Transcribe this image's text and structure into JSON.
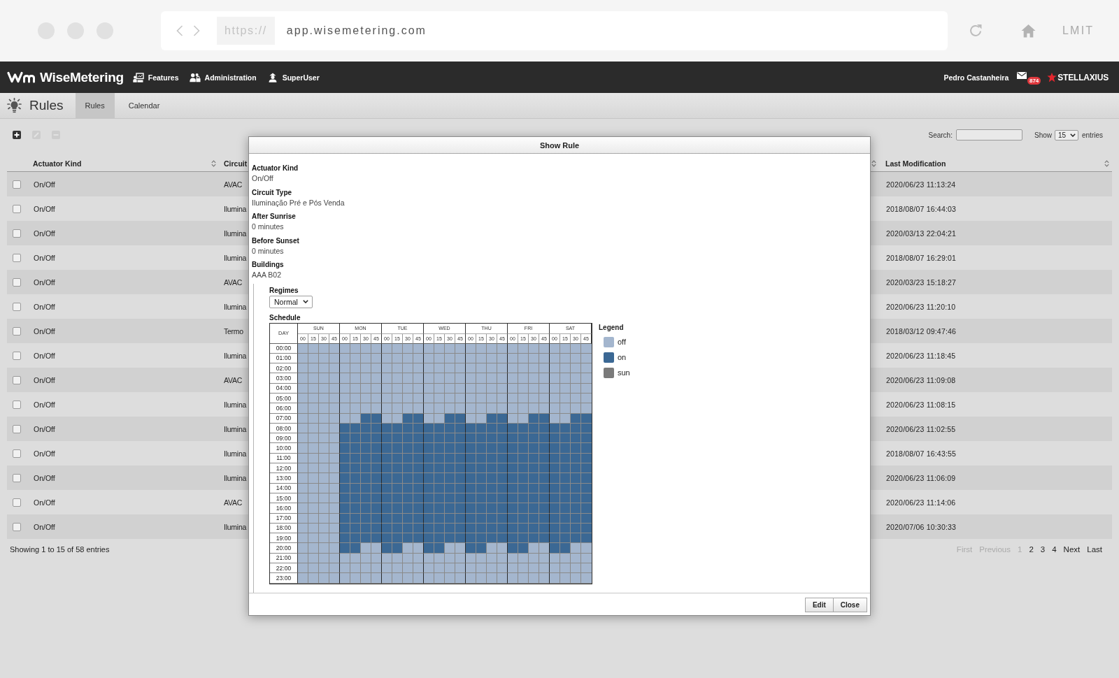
{
  "browser": {
    "scheme": "https://",
    "url": "app.wisemetering.com",
    "profile": "LMIT"
  },
  "header": {
    "logo": "WiseMetering",
    "nav": [
      {
        "label": "Features",
        "kind": "board"
      },
      {
        "label": "Administration",
        "kind": "users"
      },
      {
        "label": "SuperUser",
        "kind": "user"
      }
    ],
    "user": "Pedro Castanheira",
    "mail_count": "874",
    "company": "STELLAXIUS"
  },
  "page": {
    "title": "Rules",
    "tabs": [
      {
        "label": "Rules",
        "selected": true
      },
      {
        "label": "Calendar",
        "selected": false
      }
    ]
  },
  "toolbar": {
    "actions": [
      {
        "kind": "add",
        "disabled": false
      },
      {
        "kind": "edit",
        "disabled": true
      },
      {
        "kind": "remove",
        "disabled": true
      }
    ]
  },
  "table_controls": {
    "search_label": "Search:",
    "show_label": "Show",
    "page_size": "15",
    "entries_label": "entries"
  },
  "table": {
    "columns": [
      {
        "label": "Actuator Kind"
      },
      {
        "label": "Circuit"
      },
      {
        "label": "Last Modification"
      }
    ],
    "rows": [
      {
        "checked": false,
        "actuator_kind": "On/Off",
        "circuit": "AVAC",
        "last_modification": "2020/06/23 11:13:24"
      },
      {
        "checked": false,
        "actuator_kind": "On/Off",
        "circuit": "Ilumina",
        "last_modification": "2018/08/07 16:44:03"
      },
      {
        "checked": false,
        "actuator_kind": "On/Off",
        "circuit": "Ilumina",
        "last_modification": "2020/03/13 22:04:21"
      },
      {
        "checked": false,
        "actuator_kind": "On/Off",
        "circuit": "Ilumina",
        "last_modification": "2018/08/07 16:29:01"
      },
      {
        "checked": false,
        "actuator_kind": "On/Off",
        "circuit": "AVAC",
        "last_modification": "2020/03/23 15:18:27"
      },
      {
        "checked": false,
        "actuator_kind": "On/Off",
        "circuit": "Ilumina",
        "last_modification": "2020/06/23 11:20:10"
      },
      {
        "checked": false,
        "actuator_kind": "On/Off",
        "circuit": "Termo",
        "last_modification": "2018/03/12 09:47:46"
      },
      {
        "checked": false,
        "actuator_kind": "On/Off",
        "circuit": "Ilumina",
        "last_modification": "2020/06/23 11:18:45"
      },
      {
        "checked": false,
        "actuator_kind": "On/Off",
        "circuit": "AVAC",
        "last_modification": "2020/06/23 11:09:08"
      },
      {
        "checked": false,
        "actuator_kind": "On/Off",
        "circuit": "Ilumina",
        "last_modification": "2020/06/23 11:08:15"
      },
      {
        "checked": false,
        "actuator_kind": "On/Off",
        "circuit": "Ilumina",
        "last_modification": "2020/06/23 11:02:55"
      },
      {
        "checked": false,
        "actuator_kind": "On/Off",
        "circuit": "Ilumina",
        "last_modification": "2018/08/07 16:43:55"
      },
      {
        "checked": false,
        "actuator_kind": "On/Off",
        "circuit": "Ilumina",
        "last_modification": "2020/06/23 11:06:09"
      },
      {
        "checked": false,
        "actuator_kind": "On/Off",
        "circuit": "AVAC",
        "last_modification": "2020/06/23 11:14:06"
      },
      {
        "checked": false,
        "actuator_kind": "On/Off",
        "circuit": "Ilumina",
        "last_modification": "2020/07/06 10:30:33"
      }
    ]
  },
  "footer": {
    "info": "Showing 1 to 15 of 58 entries",
    "pagination": [
      {
        "label": "First",
        "disabled": true
      },
      {
        "label": "Previous",
        "disabled": true
      },
      {
        "label": "1",
        "disabled": true
      },
      {
        "label": "2",
        "disabled": false
      },
      {
        "label": "3",
        "disabled": false
      },
      {
        "label": "4",
        "disabled": false
      },
      {
        "label": "Next",
        "disabled": false
      },
      {
        "label": "Last",
        "disabled": false
      }
    ]
  },
  "dialog": {
    "title": "Show Rule",
    "fields": [
      {
        "label": "Actuator Kind",
        "value": "On/Off"
      },
      {
        "label": "Circuit Type",
        "value": "Iluminação Pré e Pós Venda"
      },
      {
        "label": "After Sunrise",
        "value": "0 minutes"
      },
      {
        "label": "Before Sunset",
        "value": "0 minutes"
      },
      {
        "label": "Buildings",
        "value": "AAA B02"
      }
    ],
    "regimes": {
      "label": "Regimes",
      "value": "Normal"
    },
    "schedule": {
      "label": "Schedule",
      "corner": "DAY",
      "days": [
        {
          "label": "SUN",
          "quarters": [
            "00",
            "15",
            "30",
            "45"
          ]
        },
        {
          "label": "MON",
          "quarters": [
            "00",
            "15",
            "30",
            "45"
          ]
        },
        {
          "label": "TUE",
          "quarters": [
            "00",
            "15",
            "30",
            "45"
          ]
        },
        {
          "label": "WED",
          "quarters": [
            "00",
            "15",
            "30",
            "45"
          ]
        },
        {
          "label": "THU",
          "quarters": [
            "00",
            "15",
            "30",
            "45"
          ]
        },
        {
          "label": "FRI",
          "quarters": [
            "00",
            "15",
            "30",
            "45"
          ]
        },
        {
          "label": "SAT",
          "quarters": [
            "00",
            "15",
            "30",
            "45"
          ]
        }
      ],
      "rows": [
        {
          "time": "00:00",
          "on": [
            false,
            false,
            false,
            false,
            false,
            false,
            false,
            false,
            false,
            false,
            false,
            false,
            false,
            false,
            false,
            false,
            false,
            false,
            false,
            false,
            false,
            false,
            false,
            false,
            false,
            false,
            false,
            false
          ]
        },
        {
          "time": "01:00",
          "on": [
            false,
            false,
            false,
            false,
            false,
            false,
            false,
            false,
            false,
            false,
            false,
            false,
            false,
            false,
            false,
            false,
            false,
            false,
            false,
            false,
            false,
            false,
            false,
            false,
            false,
            false,
            false,
            false
          ]
        },
        {
          "time": "02:00",
          "on": [
            false,
            false,
            false,
            false,
            false,
            false,
            false,
            false,
            false,
            false,
            false,
            false,
            false,
            false,
            false,
            false,
            false,
            false,
            false,
            false,
            false,
            false,
            false,
            false,
            false,
            false,
            false,
            false
          ]
        },
        {
          "time": "03:00",
          "on": [
            false,
            false,
            false,
            false,
            false,
            false,
            false,
            false,
            false,
            false,
            false,
            false,
            false,
            false,
            false,
            false,
            false,
            false,
            false,
            false,
            false,
            false,
            false,
            false,
            false,
            false,
            false,
            false
          ]
        },
        {
          "time": "04:00",
          "on": [
            false,
            false,
            false,
            false,
            false,
            false,
            false,
            false,
            false,
            false,
            false,
            false,
            false,
            false,
            false,
            false,
            false,
            false,
            false,
            false,
            false,
            false,
            false,
            false,
            false,
            false,
            false,
            false
          ]
        },
        {
          "time": "05:00",
          "on": [
            false,
            false,
            false,
            false,
            false,
            false,
            false,
            false,
            false,
            false,
            false,
            false,
            false,
            false,
            false,
            false,
            false,
            false,
            false,
            false,
            false,
            false,
            false,
            false,
            false,
            false,
            false,
            false
          ]
        },
        {
          "time": "06:00",
          "on": [
            false,
            false,
            false,
            false,
            false,
            false,
            false,
            false,
            false,
            false,
            false,
            false,
            false,
            false,
            false,
            false,
            false,
            false,
            false,
            false,
            false,
            false,
            false,
            false,
            false,
            false,
            false,
            false
          ]
        },
        {
          "time": "07:00",
          "on": [
            false,
            false,
            false,
            false,
            false,
            false,
            true,
            true,
            false,
            false,
            true,
            true,
            false,
            false,
            true,
            true,
            false,
            false,
            true,
            true,
            false,
            false,
            true,
            true,
            false,
            false,
            true,
            true
          ]
        },
        {
          "time": "08:00",
          "on": [
            false,
            false,
            false,
            false,
            true,
            true,
            true,
            true,
            true,
            true,
            true,
            true,
            true,
            true,
            true,
            true,
            true,
            true,
            true,
            true,
            true,
            true,
            true,
            true,
            true,
            true,
            true,
            true
          ]
        },
        {
          "time": "09:00",
          "on": [
            false,
            false,
            false,
            false,
            true,
            true,
            true,
            true,
            true,
            true,
            true,
            true,
            true,
            true,
            true,
            true,
            true,
            true,
            true,
            true,
            true,
            true,
            true,
            true,
            true,
            true,
            true,
            true
          ]
        },
        {
          "time": "10:00",
          "on": [
            false,
            false,
            false,
            false,
            true,
            true,
            true,
            true,
            true,
            true,
            true,
            true,
            true,
            true,
            true,
            true,
            true,
            true,
            true,
            true,
            true,
            true,
            true,
            true,
            true,
            true,
            true,
            true
          ]
        },
        {
          "time": "11:00",
          "on": [
            false,
            false,
            false,
            false,
            true,
            true,
            true,
            true,
            true,
            true,
            true,
            true,
            true,
            true,
            true,
            true,
            true,
            true,
            true,
            true,
            true,
            true,
            true,
            true,
            true,
            true,
            true,
            true
          ]
        },
        {
          "time": "12:00",
          "on": [
            false,
            false,
            false,
            false,
            true,
            true,
            true,
            true,
            true,
            true,
            true,
            true,
            true,
            true,
            true,
            true,
            true,
            true,
            true,
            true,
            true,
            true,
            true,
            true,
            true,
            true,
            true,
            true
          ]
        },
        {
          "time": "13:00",
          "on": [
            false,
            false,
            false,
            false,
            true,
            true,
            true,
            true,
            true,
            true,
            true,
            true,
            true,
            true,
            true,
            true,
            true,
            true,
            true,
            true,
            true,
            true,
            true,
            true,
            true,
            true,
            true,
            true
          ]
        },
        {
          "time": "14:00",
          "on": [
            false,
            false,
            false,
            false,
            true,
            true,
            true,
            true,
            true,
            true,
            true,
            true,
            true,
            true,
            true,
            true,
            true,
            true,
            true,
            true,
            true,
            true,
            true,
            true,
            true,
            true,
            true,
            true
          ]
        },
        {
          "time": "15:00",
          "on": [
            false,
            false,
            false,
            false,
            true,
            true,
            true,
            true,
            true,
            true,
            true,
            true,
            true,
            true,
            true,
            true,
            true,
            true,
            true,
            true,
            true,
            true,
            true,
            true,
            true,
            true,
            true,
            true
          ]
        },
        {
          "time": "16:00",
          "on": [
            false,
            false,
            false,
            false,
            true,
            true,
            true,
            true,
            true,
            true,
            true,
            true,
            true,
            true,
            true,
            true,
            true,
            true,
            true,
            true,
            true,
            true,
            true,
            true,
            true,
            true,
            true,
            true
          ]
        },
        {
          "time": "17:00",
          "on": [
            false,
            false,
            false,
            false,
            true,
            true,
            true,
            true,
            true,
            true,
            true,
            true,
            true,
            true,
            true,
            true,
            true,
            true,
            true,
            true,
            true,
            true,
            true,
            true,
            true,
            true,
            true,
            true
          ]
        },
        {
          "time": "18:00",
          "on": [
            false,
            false,
            false,
            false,
            true,
            true,
            true,
            true,
            true,
            true,
            true,
            true,
            true,
            true,
            true,
            true,
            true,
            true,
            true,
            true,
            true,
            true,
            true,
            true,
            true,
            true,
            true,
            true
          ]
        },
        {
          "time": "19:00",
          "on": [
            false,
            false,
            false,
            false,
            true,
            true,
            true,
            true,
            true,
            true,
            true,
            true,
            true,
            true,
            true,
            true,
            true,
            true,
            true,
            true,
            true,
            true,
            true,
            true,
            true,
            true,
            true,
            true
          ]
        },
        {
          "time": "20:00",
          "on": [
            false,
            false,
            false,
            false,
            true,
            true,
            false,
            false,
            true,
            true,
            false,
            false,
            true,
            true,
            false,
            false,
            true,
            true,
            false,
            false,
            true,
            true,
            false,
            false,
            true,
            true,
            false,
            false
          ]
        },
        {
          "time": "21:00",
          "on": [
            false,
            false,
            false,
            false,
            false,
            false,
            false,
            false,
            false,
            false,
            false,
            false,
            false,
            false,
            false,
            false,
            false,
            false,
            false,
            false,
            false,
            false,
            false,
            false,
            false,
            false,
            false,
            false
          ]
        },
        {
          "time": "22:00",
          "on": [
            false,
            false,
            false,
            false,
            false,
            false,
            false,
            false,
            false,
            false,
            false,
            false,
            false,
            false,
            false,
            false,
            false,
            false,
            false,
            false,
            false,
            false,
            false,
            false,
            false,
            false,
            false,
            false
          ]
        },
        {
          "time": "23:00",
          "on": [
            false,
            false,
            false,
            false,
            false,
            false,
            false,
            false,
            false,
            false,
            false,
            false,
            false,
            false,
            false,
            false,
            false,
            false,
            false,
            false,
            false,
            false,
            false,
            false,
            false,
            false,
            false,
            false
          ]
        }
      ],
      "legend": {
        "title": "Legend",
        "items": [
          {
            "label": "off",
            "color": "#a4b6ce"
          },
          {
            "label": "on",
            "color": "#3b6894"
          },
          {
            "label": "sun",
            "color": "#7a7a7a"
          }
        ]
      }
    },
    "buttons": [
      {
        "label": "Edit"
      },
      {
        "label": "Close"
      }
    ]
  }
}
